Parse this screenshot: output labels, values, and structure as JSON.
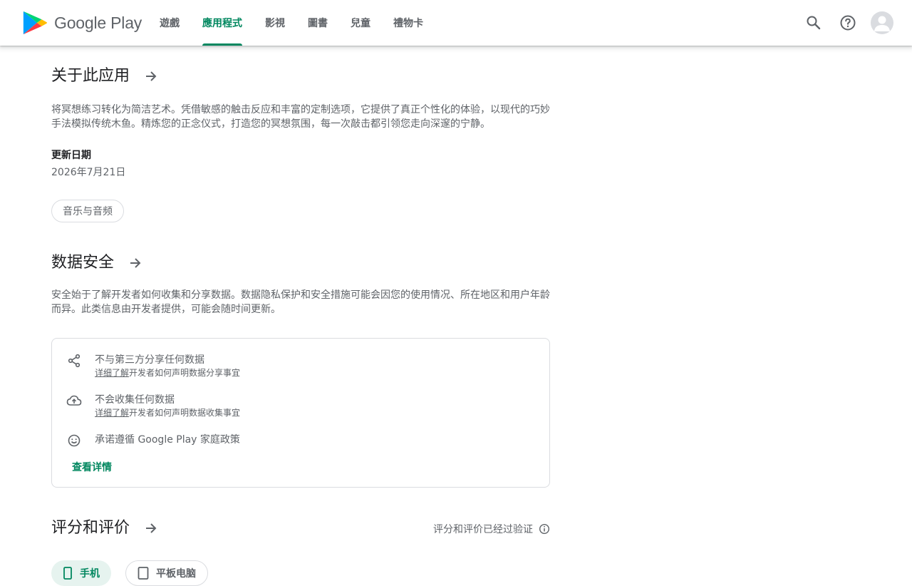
{
  "header": {
    "brand": "Google Play",
    "nav": [
      {
        "label": "遊戲",
        "active": false
      },
      {
        "label": "應用程式",
        "active": true
      },
      {
        "label": "影視",
        "active": false
      },
      {
        "label": "圖書",
        "active": false
      },
      {
        "label": "兒童",
        "active": false
      },
      {
        "label": "禮物卡",
        "active": false
      }
    ],
    "icons": [
      "search-icon",
      "help-icon",
      "account-icon"
    ]
  },
  "about": {
    "title": "关于此应用",
    "description": "将冥想练习转化为简洁艺术。凭借敏感的触击反应和丰富的定制选项，它提供了真正个性化的体验，以现代的巧妙手法模拟传统木鱼。精炼您的正念仪式，打造您的冥想氛围，每一次敲击都引领您走向深邃的宁静。",
    "updated_label": "更新日期",
    "updated_value": "2026年7月21日",
    "category": "音乐与音频"
  },
  "data_safety": {
    "title": "数据安全",
    "description": "安全始于了解开发者如何收集和分享数据。数据隐私保护和安全措施可能会因您的使用情况、所在地区和用户年龄而异。此类信息由开发者提供，可能会随时间更新。",
    "items": [
      {
        "icon": "share-icon",
        "main": "不与第三方分享任何数据",
        "link": "详细了解",
        "sub": "开发者如何声明数据分享事宜"
      },
      {
        "icon": "cloud-upload-icon",
        "main": "不会收集任何数据",
        "link": "详细了解",
        "sub": "开发者如何声明数据收集事宜"
      },
      {
        "icon": "smiley-icon",
        "main": "承诺遵循 Google Play 家庭政策"
      }
    ],
    "view_details": "查看详情"
  },
  "ratings": {
    "title": "评分和评价",
    "verified": "评分和评价已经过验证",
    "devices": [
      {
        "label": "手机",
        "active": true,
        "icon": "phone-icon"
      },
      {
        "label": "平板电脑",
        "active": false,
        "icon": "tablet-icon"
      }
    ]
  },
  "colors": {
    "accent": "#01875f",
    "text_secondary": "#5f6368",
    "text_primary": "#202124",
    "border": "#dadce0",
    "chip_active_bg": "#e6f3ef"
  }
}
